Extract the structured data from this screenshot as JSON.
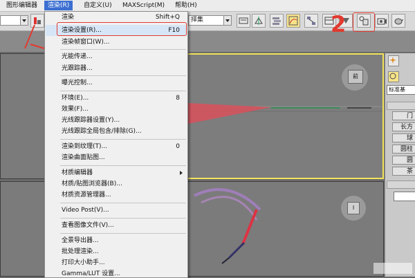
{
  "menubar": {
    "items": [
      {
        "label": "图形编辑器"
      },
      {
        "label": "渲染(R)"
      },
      {
        "label": "自定义(U)"
      },
      {
        "label": "MAXScript(M)"
      },
      {
        "label": "帮助(H)"
      }
    ]
  },
  "toolbar": {
    "left_input_value": "",
    "selection_set_value": "择集",
    "accent": "#f3e45a"
  },
  "render_menu": {
    "items": [
      {
        "label": "渲染",
        "shortcut": "Shift+Q"
      },
      {
        "label": "渲染设置(R)...",
        "shortcut": "F10"
      },
      {
        "label": "渲染帧窗口(W)...",
        "shortcut": ""
      },
      {
        "label": "光能传递...",
        "shortcut": ""
      },
      {
        "label": "光跟踪器...",
        "shortcut": ""
      },
      {
        "label": "曝光控制...",
        "shortcut": ""
      },
      {
        "label": "环境(E)...",
        "shortcut": "8"
      },
      {
        "label": "效果(F)...",
        "shortcut": ""
      },
      {
        "label": "光线跟踪器设置(Y)...",
        "shortcut": ""
      },
      {
        "label": "光线跟踪全局包含/排除(G)...",
        "shortcut": ""
      },
      {
        "label": "渲染到纹理(T)...",
        "shortcut": "0"
      },
      {
        "label": "渲染曲面贴图...",
        "shortcut": ""
      },
      {
        "label": "材质编辑器",
        "shortcut": ""
      },
      {
        "label": "材质/贴图浏览器(B)...",
        "shortcut": ""
      },
      {
        "label": "材质资源管理器...",
        "shortcut": ""
      },
      {
        "label": "Video Post(V)...",
        "shortcut": ""
      },
      {
        "label": "查看图像文件(V)...",
        "shortcut": ""
      },
      {
        "label": "全景导出器...",
        "shortcut": ""
      },
      {
        "label": "批处理渲染...",
        "shortcut": ""
      },
      {
        "label": "打印大小助手...",
        "shortcut": ""
      },
      {
        "label": "Gamma/LUT 设置...",
        "shortcut": ""
      }
    ]
  },
  "viewport": {
    "top_right_label": "前",
    "bottom_right_label": "Ⅰ"
  },
  "command_panel": {
    "dropdown_value": "标准基",
    "buttons": [
      "门",
      "长方",
      "球",
      "圆柱",
      "圆",
      "茶"
    ]
  },
  "annotations": {
    "number_1": "1",
    "number_2": "2",
    "color": "#e23a2f"
  }
}
